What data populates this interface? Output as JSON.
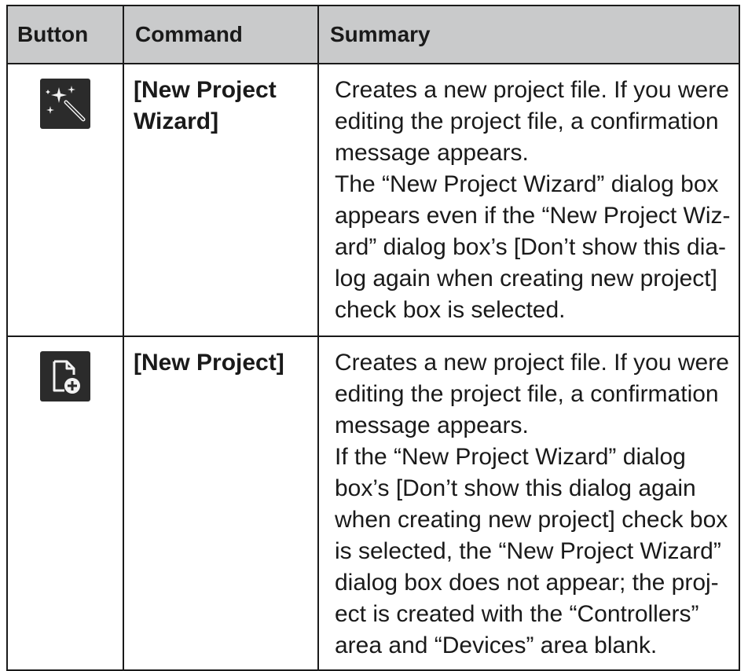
{
  "table": {
    "headers": {
      "button": "Button",
      "command": "Command",
      "summary": "Summary"
    },
    "rows": [
      {
        "icon": "magic-wand-icon",
        "command": "[New Project Wizard]",
        "summary_p1": "Creates a new project file. If you were editing the project file, a confirmation message appears.",
        "summary_p2": "The “New Project Wizard” dialog box appears even if the “New Project Wiz-ard” dialog box’s [Don’t show this dia-log again when creating new project] check box is selected."
      },
      {
        "icon": "new-document-icon",
        "command": "[New Project]",
        "summary_p1": "Creates a new project file. If you were editing the project file, a confirmation message appears.",
        "summary_p2": "If the “New Project Wizard” dialog box’s [Don’t show this dialog again when creating new project] check box is selected, the “New Project Wizard” dialog box does not appear; the proj-ect is created with the “Controllers” area and “Devices” area blank."
      }
    ]
  },
  "colors": {
    "header_background": "#c9cacb",
    "icon_background": "#2b2b2b",
    "border": "#1a1a1a"
  }
}
